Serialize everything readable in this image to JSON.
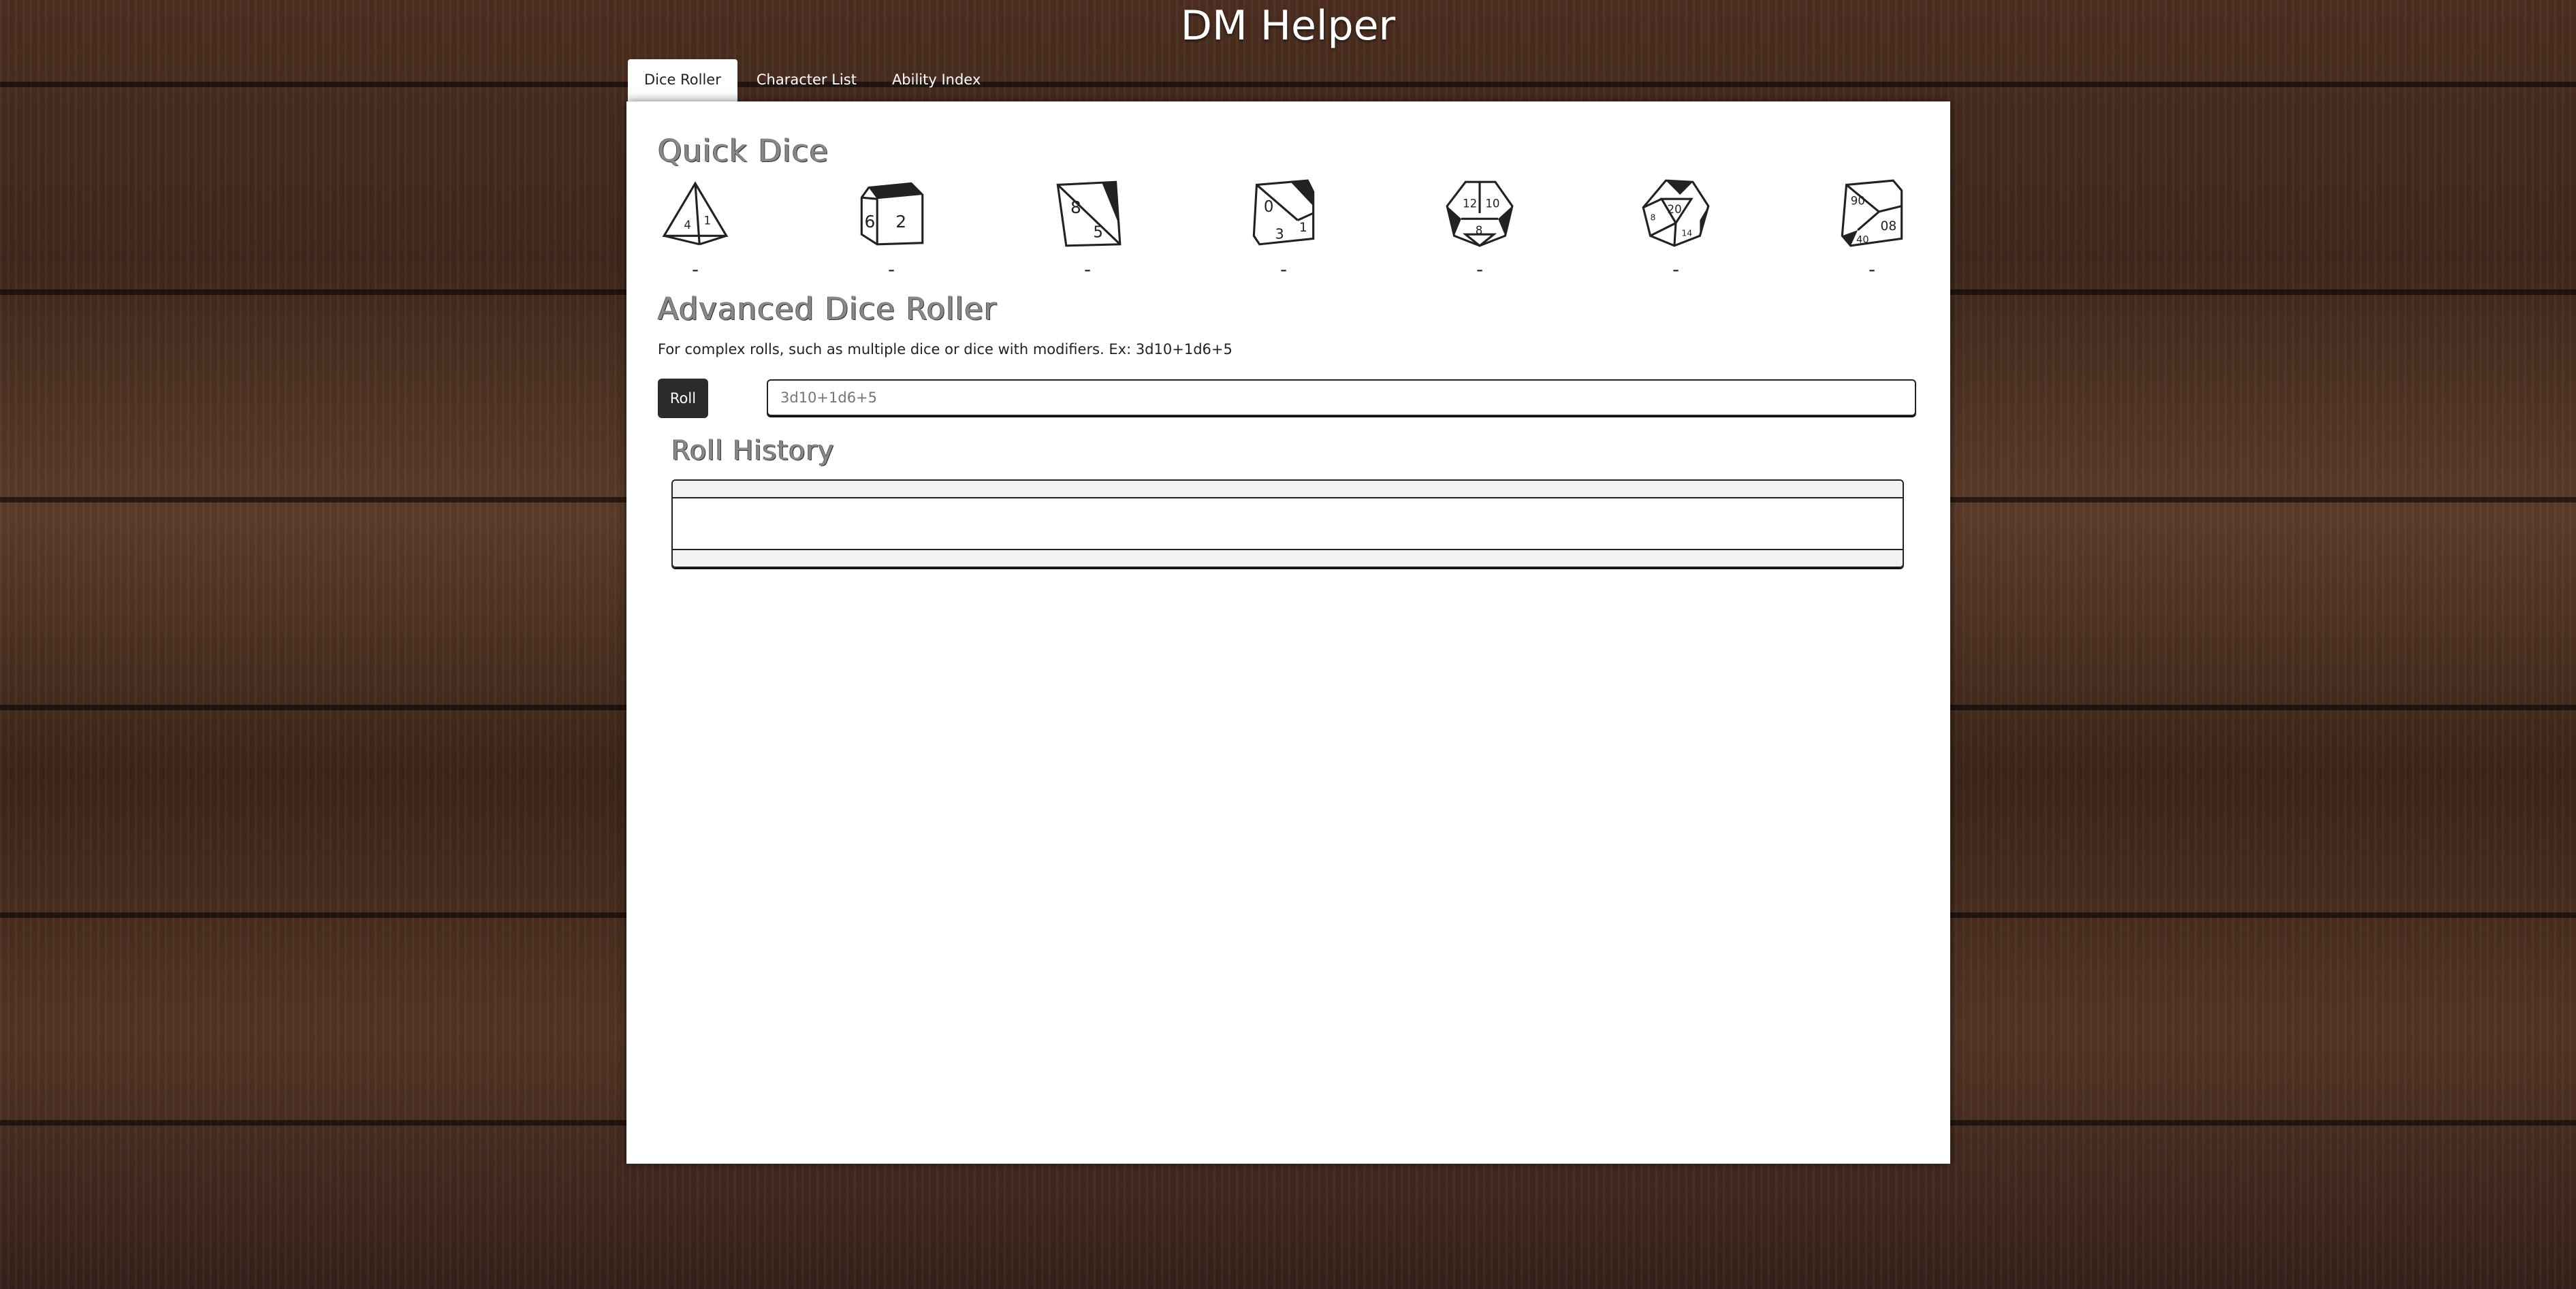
{
  "app": {
    "title": "DM Helper"
  },
  "tabs": [
    {
      "label": "Dice Roller",
      "active": true
    },
    {
      "label": "Character List",
      "active": false
    },
    {
      "label": "Ability Index",
      "active": false
    }
  ],
  "quick_dice": {
    "heading": "Quick Dice",
    "dice": [
      {
        "name": "d4-icon",
        "result": "-"
      },
      {
        "name": "d6-icon",
        "result": "-"
      },
      {
        "name": "d8-icon",
        "result": "-"
      },
      {
        "name": "d10-icon",
        "result": "-"
      },
      {
        "name": "d12-icon",
        "result": "-"
      },
      {
        "name": "d20-icon",
        "result": "-"
      },
      {
        "name": "d100-icon",
        "result": "-"
      }
    ]
  },
  "advanced": {
    "heading": "Advanced Dice Roller",
    "description": "For complex rolls, such as multiple dice or dice with modifiers. Ex: 3d10+1d6+5",
    "roll_label": "Roll",
    "input_placeholder": "3d10+1d6+5",
    "input_value": ""
  },
  "history": {
    "heading": "Roll History",
    "entries": []
  }
}
